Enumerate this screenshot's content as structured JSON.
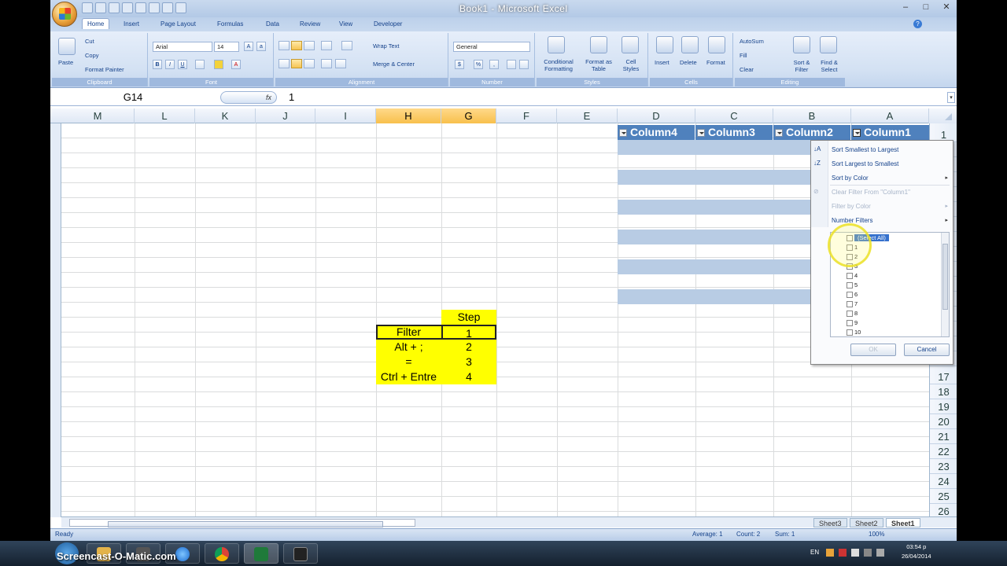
{
  "titlebar": {
    "title": "Book1 - Microsoft Excel"
  },
  "ribbon": {
    "tabs": [
      "Home",
      "Insert",
      "Page Layout",
      "Formulas",
      "Data",
      "Review",
      "View",
      "Developer"
    ],
    "clipboard": {
      "paste": "Paste",
      "cut": "Cut",
      "copy": "Copy",
      "format_painter": "Format Painter",
      "label": "Clipboard"
    },
    "font": {
      "name": "Arial",
      "size": "14",
      "label": "Font"
    },
    "alignment": {
      "wrap": "Wrap Text",
      "merge": "Merge & Center",
      "label": "Alignment"
    },
    "number": {
      "format": "General",
      "label": "Number"
    },
    "styles": {
      "conditional": "Conditional Formatting",
      "format_table": "Format as Table",
      "cell_styles": "Cell Styles",
      "label": "Styles"
    },
    "cells": {
      "insert": "Insert",
      "delete": "Delete",
      "format": "Format",
      "label": "Cells"
    },
    "editing": {
      "autosum": "AutoSum",
      "fill": "Fill",
      "clear": "Clear",
      "sort": "Sort & Filter",
      "find": "Find & Select",
      "label": "Editing"
    }
  },
  "formula_bar": {
    "name_box": "G14",
    "fx": "fx",
    "value": "1"
  },
  "columns": [
    "M",
    "L",
    "K",
    "J",
    "I",
    "H",
    "G",
    "F",
    "E",
    "D",
    "C",
    "B",
    "A"
  ],
  "rows": [
    "1",
    "2",
    "3",
    "4",
    "5",
    "6",
    "7",
    "8",
    "9",
    "10",
    "11",
    "12",
    "13",
    "14",
    "15",
    "16",
    "17",
    "18",
    "19",
    "20",
    "21",
    "22",
    "23",
    "24",
    "25",
    "26"
  ],
  "table": {
    "headers": [
      "Column4",
      "Column3",
      "Column2",
      "Column1"
    ]
  },
  "steps": {
    "header": "Step",
    "rows": [
      {
        "action": "Filter",
        "step": "1"
      },
      {
        "action": "Alt + ;",
        "step": "2"
      },
      {
        "action": "=",
        "step": "3"
      },
      {
        "action": "Ctrl + Entre",
        "step": "4"
      }
    ]
  },
  "filter_menu": {
    "sort_asc": "Sort Smallest to Largest",
    "sort_desc": "Sort Largest to Smallest",
    "sort_color": "Sort by Color",
    "clear_filter": "Clear Filter From \"Column1\"",
    "filter_color": "Filter by Color",
    "number_filters": "Number Filters",
    "select_all": "(Select All)",
    "values": [
      "1",
      "2",
      "3",
      "4",
      "5",
      "6",
      "7",
      "8",
      "9",
      "10"
    ],
    "ok": "OK",
    "cancel": "Cancel"
  },
  "sheets": [
    "Sheet3",
    "Sheet2",
    "Sheet1"
  ],
  "status": {
    "ready": "Ready",
    "average": "Average: 1",
    "count": "Count: 2",
    "sum": "Sum: 1",
    "zoom": "100%"
  },
  "taskbar": {
    "watermark": "Screencast-O-Matic.com",
    "lang": "EN",
    "time": "03:54 p",
    "date": "26/04/2014"
  }
}
